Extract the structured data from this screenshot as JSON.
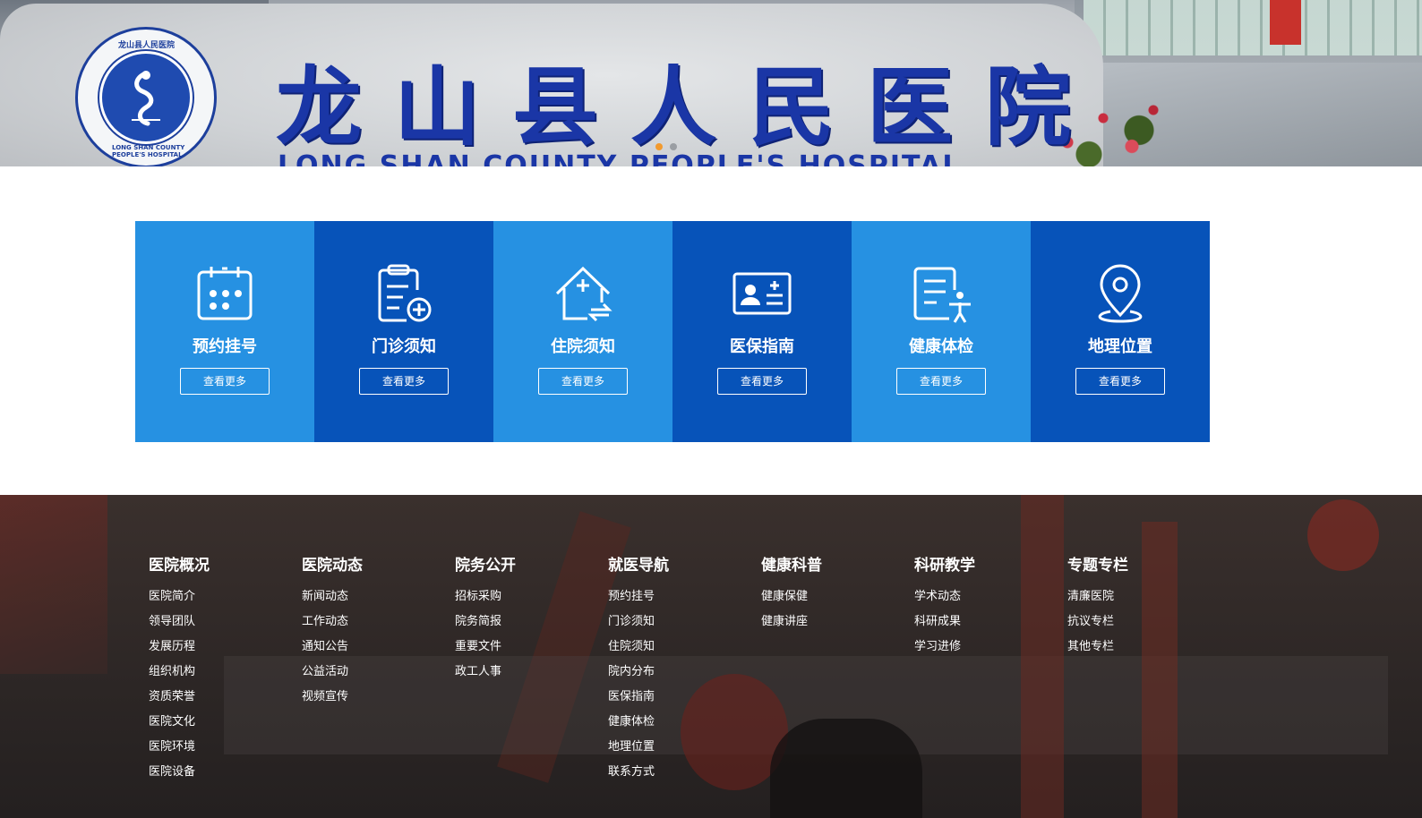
{
  "banner": {
    "title": "龙山县人民医院",
    "subtitle": "LONG SHAN COUNTY PEOPLE'S HOSPITAL",
    "logo_text_top": "龙山县人民医院",
    "logo_text_bottom": "LONG SHAN COUNTY PEOPLE'S HOSPITAL",
    "slides": 2,
    "active_slide": 1
  },
  "services": [
    {
      "label": "预约挂号",
      "more": "查看更多",
      "icon": "calendar-icon",
      "color": "#2691e2"
    },
    {
      "label": "门诊须知",
      "more": "查看更多",
      "icon": "clipboard-plus-icon",
      "color": "#0753b9"
    },
    {
      "label": "住院须知",
      "more": "查看更多",
      "icon": "house-plus-icon",
      "color": "#2691e2"
    },
    {
      "label": "医保指南",
      "more": "查看更多",
      "icon": "id-card-icon",
      "color": "#0753b9"
    },
    {
      "label": "健康体检",
      "more": "查看更多",
      "icon": "document-person-icon",
      "color": "#2691e2"
    },
    {
      "label": "地理位置",
      "more": "查看更多",
      "icon": "map-pin-icon",
      "color": "#0753b9"
    }
  ],
  "footer": {
    "columns": [
      {
        "title": "医院概况",
        "items": [
          "医院简介",
          "领导团队",
          "发展历程",
          "组织机构",
          "资质荣誉",
          "医院文化",
          "医院环境",
          "医院设备"
        ]
      },
      {
        "title": "医院动态",
        "items": [
          "新闻动态",
          "工作动态",
          "通知公告",
          "公益活动",
          "视频宣传"
        ]
      },
      {
        "title": "院务公开",
        "items": [
          "招标采购",
          "院务简报",
          "重要文件",
          "政工人事"
        ]
      },
      {
        "title": "就医导航",
        "items": [
          "预约挂号",
          "门诊须知",
          "住院须知",
          "院内分布",
          "医保指南",
          "健康体检",
          "地理位置",
          "联系方式"
        ]
      },
      {
        "title": "健康科普",
        "items": [
          "健康保健",
          "健康讲座"
        ]
      },
      {
        "title": "科研教学",
        "items": [
          "学术动态",
          "科研成果",
          "学习进修"
        ]
      },
      {
        "title": "专题专栏",
        "items": [
          "清廉医院",
          "抗议专栏",
          "其他专栏"
        ]
      }
    ]
  },
  "colors": {
    "tile_light": "#2691e2",
    "tile_dark": "#0753b9",
    "dot_active": "#f29a2e"
  }
}
